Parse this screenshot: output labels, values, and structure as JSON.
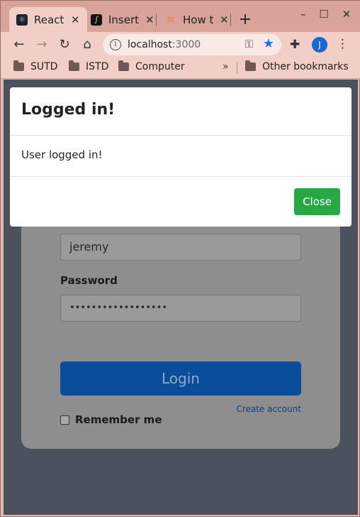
{
  "browser": {
    "tabs": [
      {
        "label": "React",
        "favicon": "react-icon",
        "active": true
      },
      {
        "label": "Insert",
        "favicon": "insert-icon",
        "active": false
      },
      {
        "label": "How t",
        "favicon": "stackoverflow-icon",
        "active": false
      }
    ],
    "new_tab_glyph": "+",
    "address": {
      "host": "localhost",
      "port": ":3000"
    },
    "profile_initial": "J",
    "bookmarks": [
      {
        "label": "SUTD"
      },
      {
        "label": "ISTD"
      },
      {
        "label": "Computer"
      }
    ],
    "bookmarks_more": "»",
    "other_bookmarks": "Other bookmarks"
  },
  "login_form": {
    "username_value": "jeremy",
    "password_label": "Password",
    "password_value": "••••••••••••••••••",
    "remember_label": "Remember me",
    "login_button": "Login",
    "create_account_link": "Create account"
  },
  "modal": {
    "title": "Logged in!",
    "body": "User logged in!",
    "close_button": "Close"
  },
  "colors": {
    "modal_close_button": "#28a745",
    "login_button": "#0a4d9a",
    "profile_avatar": "#1967d2",
    "star_accent": "#1a73e8"
  }
}
